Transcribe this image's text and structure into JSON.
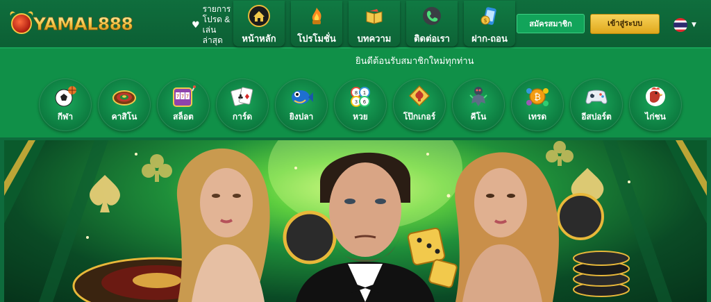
{
  "brand": {
    "logo_text": "YAMAL888"
  },
  "promo_link": {
    "label": "รายการโปรด & เล่นล่าสุด"
  },
  "nav": [
    {
      "label": "หน้าหลัก",
      "icon": "home-icon"
    },
    {
      "label": "โปรโมชั่น",
      "icon": "gift-icon"
    },
    {
      "label": "บทความ",
      "icon": "article-icon"
    },
    {
      "label": "ติดต่อเรา",
      "icon": "contact-icon"
    },
    {
      "label": "ฝาก-ถอน",
      "icon": "wallet-icon"
    }
  ],
  "auth": {
    "register_label": "สมัครสมาชิก",
    "login_label": "เข้าสู่ระบบ"
  },
  "language": {
    "icon": "thai-flag-icon"
  },
  "marquee": {
    "text": "ยินดีต้อนรับสมาชิกใหม่ทุกท่าน"
  },
  "categories": [
    {
      "label": "กีฬา",
      "icon": "sports-ball-icon"
    },
    {
      "label": "คาสิโน",
      "icon": "roulette-icon"
    },
    {
      "label": "สล็อต",
      "icon": "slot-machine-icon"
    },
    {
      "label": "การ์ด",
      "icon": "playing-cards-icon"
    },
    {
      "label": "ยิงปลา",
      "icon": "fish-icon"
    },
    {
      "label": "หวย",
      "icon": "lottery-balls-icon"
    },
    {
      "label": "โป๊กเกอร์",
      "icon": "poker-icon"
    },
    {
      "label": "คีโน",
      "icon": "keno-icon"
    },
    {
      "label": "เทรด",
      "icon": "crypto-trade-icon"
    },
    {
      "label": "อีสปอร์ต",
      "icon": "gamepad-icon"
    },
    {
      "label": "ไก่ชน",
      "icon": "rooster-icon"
    }
  ],
  "colors": {
    "primary": "#0e6b3c",
    "accent": "#109048",
    "gold": "#e0a81c",
    "register": "#12a45a"
  }
}
